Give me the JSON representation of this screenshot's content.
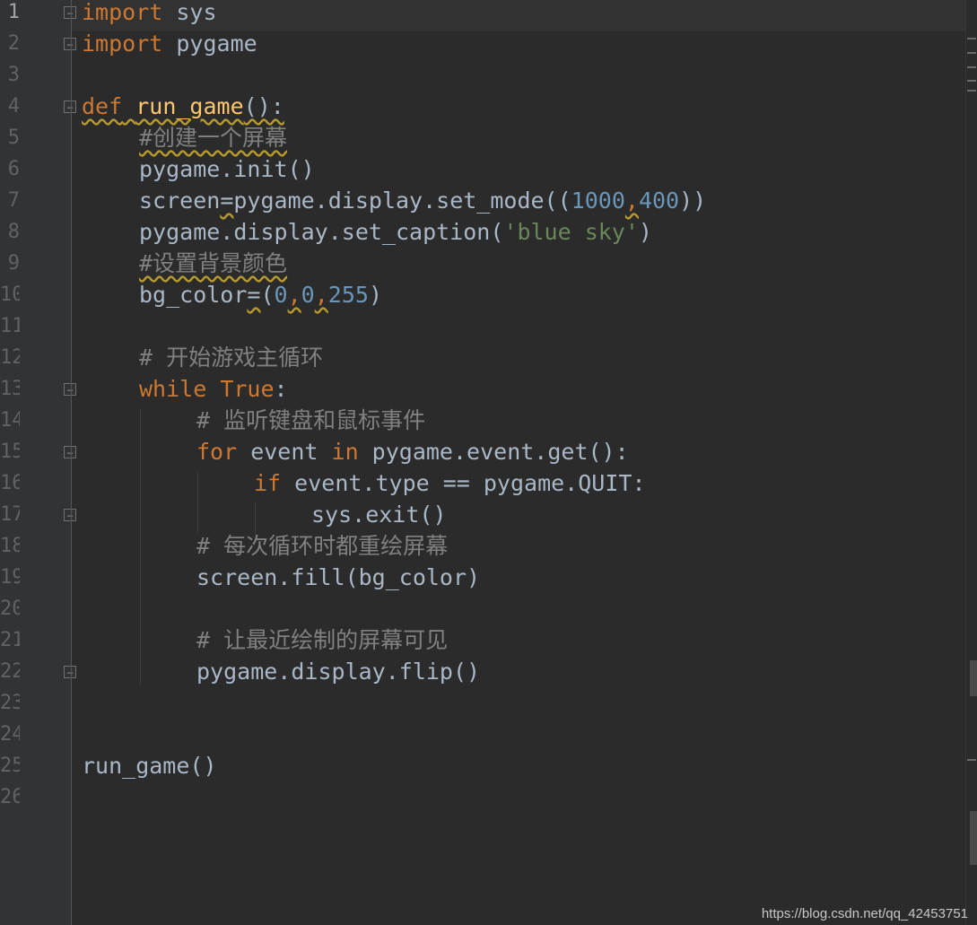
{
  "gutter": {
    "line_numbers": [
      "1",
      "2",
      "3",
      "4",
      "5",
      "6",
      "7",
      "8",
      "9",
      "10",
      "11",
      "12",
      "13",
      "14",
      "15",
      "16",
      "17",
      "18",
      "19",
      "20",
      "21",
      "22",
      "23",
      "24",
      "25",
      "26"
    ],
    "current_line": "1"
  },
  "code": {
    "l1": {
      "kw": "import",
      "rest": " sys"
    },
    "l2": {
      "kw": "import",
      "rest": " pygame"
    },
    "l4": {
      "kw": "def",
      "space": " ",
      "fn": "run_game",
      "rest": "():"
    },
    "l5": {
      "comment": "#创建一个屏幕"
    },
    "l6": {
      "text": "pygame.init()"
    },
    "l7": {
      "a": "screen",
      "eq": "=",
      "b": "pygame.display.set_mode((",
      "n1": "1000",
      "comma": ",",
      "n2": "400",
      "c": "))"
    },
    "l8": {
      "a": "pygame.display.set_caption(",
      "str": "'blue sky'",
      "c": ")"
    },
    "l9": {
      "comment": "#设置背景颜色"
    },
    "l10": {
      "a": "bg_color",
      "eq": "=",
      "p": "(",
      "n1": "0",
      "c1": ",",
      "n2": "0",
      "c2": ",",
      "n3": "255",
      "close": ")"
    },
    "l12": {
      "comment": "# 开始游戏主循环"
    },
    "l13": {
      "kw1": "while",
      "sp": " ",
      "kw2": "True",
      "rest": ":"
    },
    "l14": {
      "comment": "# 监听键盘和鼠标事件"
    },
    "l15": {
      "kw1": "for",
      "mid": " event ",
      "kw2": "in",
      "rest": " pygame.event.get():"
    },
    "l16": {
      "kw": "if",
      "rest": " event.type == pygame.QUIT:"
    },
    "l17": {
      "text": "sys.exit()"
    },
    "l18": {
      "comment": "# 每次循环时都重绘屏幕"
    },
    "l19": {
      "text": "screen.fill(bg_color)"
    },
    "l21": {
      "comment": "# 让最近绘制的屏幕可见"
    },
    "l22": {
      "text": "pygame.display.flip()"
    },
    "l25": {
      "text": "run_game()"
    }
  },
  "watermark": "https://blog.csdn.net/qq_42453751",
  "colors": {
    "background": "#2b2b2b",
    "keyword": "#cc7832",
    "function": "#ffc66d",
    "number": "#6897bb",
    "string": "#6a8759",
    "comment": "#808080",
    "text": "#a9b7c6"
  },
  "icons": {
    "fold_open": "fold-open-icon",
    "fold_end": "fold-end-icon"
  }
}
